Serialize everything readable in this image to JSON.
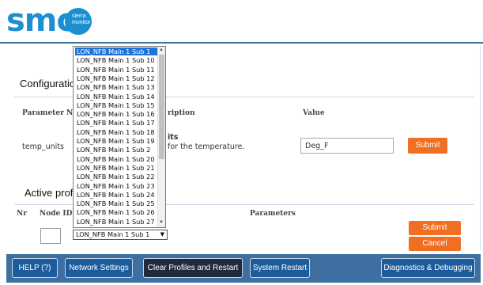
{
  "header": {
    "logo_text": "smc",
    "logo_sub_1": "sierra",
    "logo_sub_2": "monitor"
  },
  "configuration": {
    "title": "Configuratio",
    "col_name": "Parameter Na",
    "col_description": "ription",
    "col_value": "Value",
    "row": {
      "name": "temp_units",
      "desc_title": "its",
      "desc_text": "for the temperature.",
      "value": "Deg_F",
      "submit_label": "Submit"
    }
  },
  "active_profiles": {
    "title": "Active profil",
    "col_nr": "Nr",
    "col_node_id": "Node ID",
    "col_parameters": "Parameters",
    "submit_label": "Submit",
    "cancel_label": "Cancel",
    "selected_profile": "LON_NFB Main 1 Sub 1"
  },
  "dropdown": {
    "options": [
      "LON_NFB Main 1 Sub 1",
      "LON_NFB Main 1 Sub 10",
      "LON_NFB Main 1 Sub 11",
      "LON_NFB Main 1 Sub 12",
      "LON_NFB Main 1 Sub 13",
      "LON_NFB Main 1 Sub 14",
      "LON_NFB Main 1 Sub 15",
      "LON_NFB Main 1 Sub 16",
      "LON_NFB Main 1 Sub 17",
      "LON_NFB Main 1 Sub 18",
      "LON_NFB Main 1 Sub 19",
      "LON_NFB Main 1 Sub 2",
      "LON_NFB Main 1 Sub 20",
      "LON_NFB Main 1 Sub 21",
      "LON_NFB Main 1 Sub 22",
      "LON_NFB Main 1 Sub 23",
      "LON_NFB Main 1 Sub 24",
      "LON_NFB Main 1 Sub 25",
      "LON_NFB Main 1 Sub 26",
      "LON_NFB Main 1 Sub 27"
    ]
  },
  "toolbar": {
    "help": "HELP (?)",
    "network_settings": "Network Settings",
    "clear_profiles": "Clear Profiles and Restart",
    "system_restart": "System Restart",
    "diagnostics": "Diagnostics & Debugging"
  },
  "colors": {
    "brand_blue": "#1c8fd0",
    "toolbar_blue": "#3e6fa0",
    "accent_orange": "#f06f22",
    "selection_blue": "#1e73d6"
  }
}
